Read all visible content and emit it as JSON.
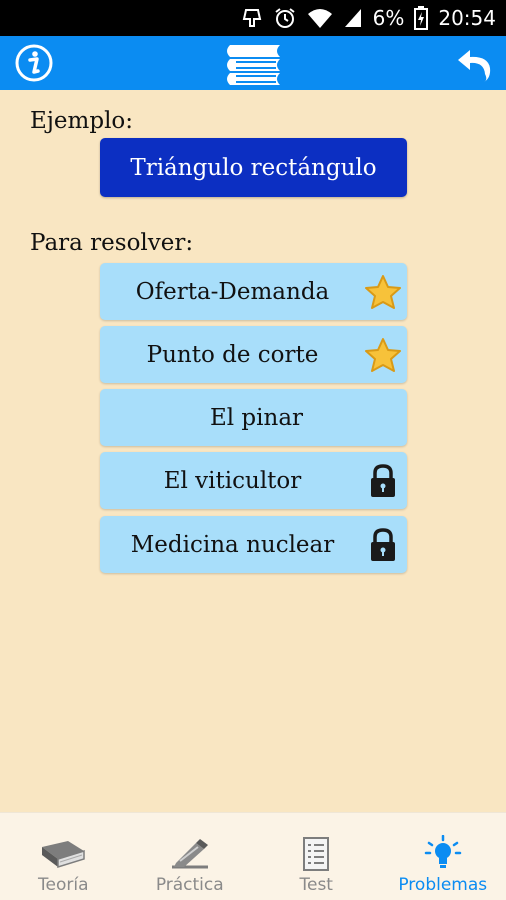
{
  "status_bar": {
    "battery": "6%",
    "time": "20:54",
    "icons": [
      "alarm-icon",
      "wifi-icon",
      "signal-icon",
      "battery-charging-icon",
      "notification-icon"
    ]
  },
  "app_bar": {
    "color": "#0b8cf2",
    "left_icon": "info-icon",
    "center_icon": "books-icon",
    "right_icon": "back-arrow-icon"
  },
  "main": {
    "example_heading": "Ejemplo:",
    "example_button": "Triángulo rectángulo",
    "problems_heading": "Para resolver:",
    "problems": [
      {
        "label": "Oferta-Demanda",
        "status": "star-icon"
      },
      {
        "label": "Punto de corte",
        "status": "star-icon"
      },
      {
        "label": "El pinar",
        "status": ""
      },
      {
        "label": "El viticultor",
        "status": "lock-icon"
      },
      {
        "label": "Medicina nuclear",
        "status": "lock-icon"
      }
    ]
  },
  "bottom_nav": {
    "items": [
      {
        "label": "Teoría",
        "icon": "book-icon",
        "active": false
      },
      {
        "label": "Práctica",
        "icon": "pencil-icon",
        "active": false
      },
      {
        "label": "Test",
        "icon": "test-sheet-icon",
        "active": false
      },
      {
        "label": "Problemas",
        "icon": "lightbulb-icon",
        "active": true
      }
    ]
  },
  "colors": {
    "background": "#f9e6c2",
    "example_button": "#0c2fc2",
    "problem_button": "#a8defa",
    "active_tab": "#0b8cf2",
    "inactive_tab": "#8a8a8a"
  }
}
